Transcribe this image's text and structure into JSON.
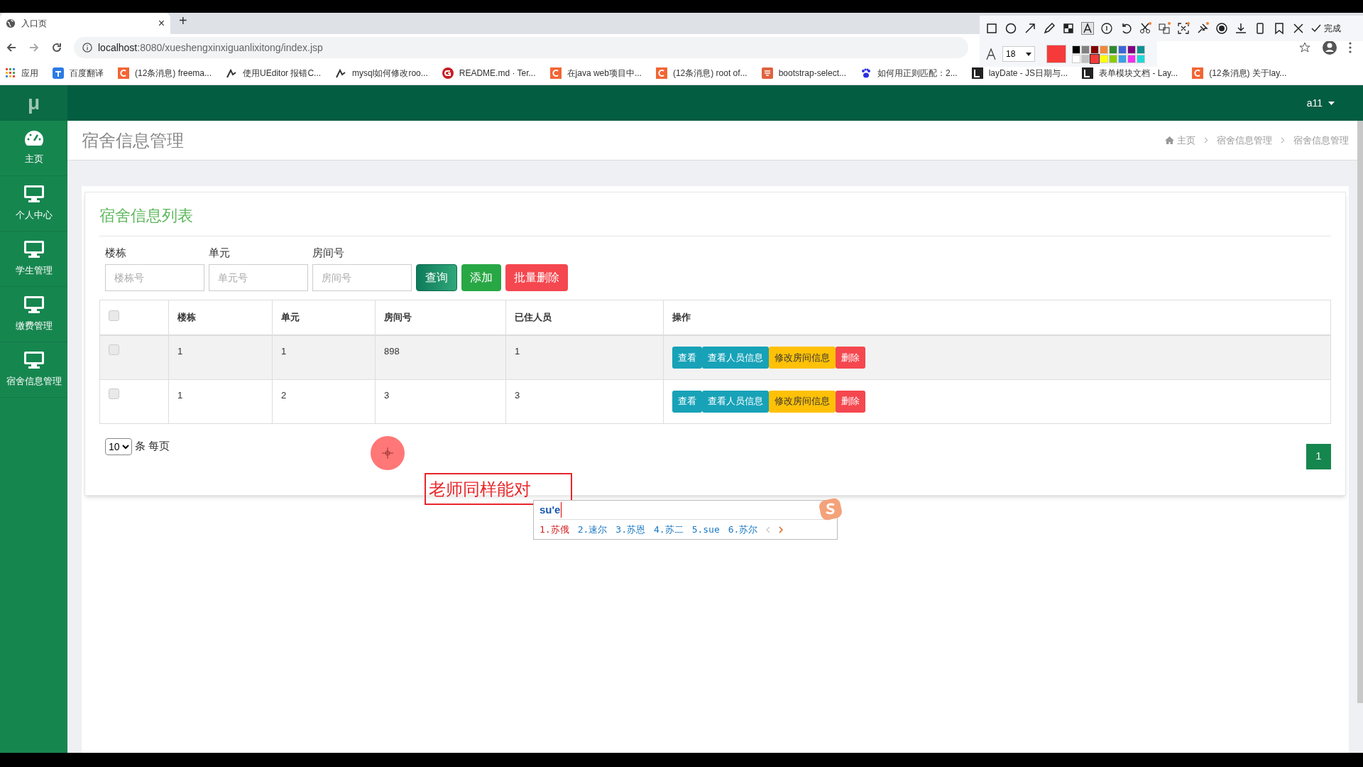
{
  "browser": {
    "tabs": [
      {
        "title": "入口页",
        "close": "×",
        "selected": true
      }
    ],
    "new_tab": "+",
    "url_host": "localhost",
    "url_rest": ":8080/xueshengxinxiguanlixitong/index.jsp",
    "bookmarks": [
      {
        "label": "应用",
        "kind": "apps"
      },
      {
        "label": "百度翻译",
        "kind": "translate"
      },
      {
        "label": "(12条消息) freema...",
        "kind": "csdn"
      },
      {
        "label": "使用UEditor 报错C...",
        "kind": "glyph"
      },
      {
        "label": "mysql如何修改roo...",
        "kind": "glyph"
      },
      {
        "label": "README.md · Ter...",
        "kind": "gitee"
      },
      {
        "label": "在java web项目中...",
        "kind": "csdn"
      },
      {
        "label": "(12条消息) root of...",
        "kind": "csdn"
      },
      {
        "label": "bootstrap-select...",
        "kind": "jian"
      },
      {
        "label": "如何用正则匹配：2...",
        "kind": "paw"
      },
      {
        "label": "layDate - JS日期与...",
        "kind": "lay"
      },
      {
        "label": "表单模块文档 - Lay...",
        "kind": "lay"
      },
      {
        "label": "(12条消息) 关于lay...",
        "kind": "csdn"
      }
    ]
  },
  "capture_toolbar": {
    "done": "完成",
    "font_size": "18",
    "palette": [
      {
        "color": "#000000",
        "selected": false
      },
      {
        "color": "#808080",
        "selected": false
      },
      {
        "color": "#800000",
        "selected": false
      },
      {
        "color": "#f0883a",
        "selected": false
      },
      {
        "color": "#2e8b2e",
        "selected": false
      },
      {
        "color": "#3a66d8",
        "selected": false
      },
      {
        "color": "#800080",
        "selected": false
      },
      {
        "color": "#109090",
        "selected": false
      },
      {
        "color": "#ffffff",
        "selected": false
      },
      {
        "color": "#c0c0c0",
        "selected": false
      },
      {
        "color": "#f63a3a",
        "selected": true
      },
      {
        "color": "#ffff00",
        "selected": false
      },
      {
        "color": "#8ccc00",
        "selected": false
      },
      {
        "color": "#3aa0e8",
        "selected": false
      },
      {
        "color": "#f030f0",
        "selected": false
      },
      {
        "color": "#20d8d8",
        "selected": false
      }
    ]
  },
  "app": {
    "logo": "μ",
    "user": "a11",
    "sidebar": [
      {
        "label": "主页",
        "kind": "dashboard"
      },
      {
        "label": "个人中心",
        "kind": "monitor"
      },
      {
        "label": "学生管理",
        "kind": "monitor"
      },
      {
        "label": "缴费管理",
        "kind": "monitor"
      },
      {
        "label": "宿舍信息管理",
        "kind": "monitor"
      }
    ],
    "page_title": "宿舍信息管理",
    "breadcrumb": [
      "主页",
      "宿舍信息管理",
      "宿舍信息管理"
    ],
    "card_title": "宿舍信息列表",
    "filters": [
      {
        "label": "楼栋",
        "placeholder": "楼栋号"
      },
      {
        "label": "单元",
        "placeholder": "单元号"
      },
      {
        "label": "房间号",
        "placeholder": "房间号"
      }
    ],
    "buttons": [
      {
        "label": "查询",
        "kind": "query"
      },
      {
        "label": "添加",
        "kind": "add"
      },
      {
        "label": "批量删除",
        "kind": "delete"
      }
    ],
    "table": {
      "select_all_checked": false,
      "columns": [
        "楼栋",
        "单元",
        "房间号",
        "已住人员",
        "操作"
      ],
      "rows": [
        {
          "checked": false,
          "hover": true,
          "cells": [
            "1",
            "1",
            "898",
            "1"
          ],
          "actions": [
            {
              "label": "查看",
              "kind": "info"
            },
            {
              "label": "查看人员信息",
              "kind": "info"
            },
            {
              "label": "修改房间信息",
              "kind": "warning"
            },
            {
              "label": "删除",
              "kind": "danger"
            }
          ]
        },
        {
          "checked": false,
          "hover": false,
          "cells": [
            "1",
            "2",
            "3",
            "3"
          ],
          "actions": [
            {
              "label": "查看",
              "kind": "info"
            },
            {
              "label": "查看人员信息",
              "kind": "info"
            },
            {
              "label": "修改房间信息",
              "kind": "warning"
            },
            {
              "label": "删除",
              "kind": "danger"
            }
          ]
        }
      ]
    },
    "page_size": "10",
    "page_size_label": "条 每页",
    "pages": [
      {
        "label": "1",
        "selected": true
      }
    ]
  },
  "annotation": {
    "text": "老师同样能对"
  },
  "ime": {
    "composition": "su'e",
    "candidates": [
      {
        "label": "1.苏俄",
        "selected": true
      },
      {
        "label": "2.速尔",
        "selected": false
      },
      {
        "label": "3.苏恩",
        "selected": false
      },
      {
        "label": "4.苏二",
        "selected": false
      },
      {
        "label": "5.sue",
        "selected": false
      },
      {
        "label": "6.苏尔",
        "selected": false
      }
    ]
  }
}
